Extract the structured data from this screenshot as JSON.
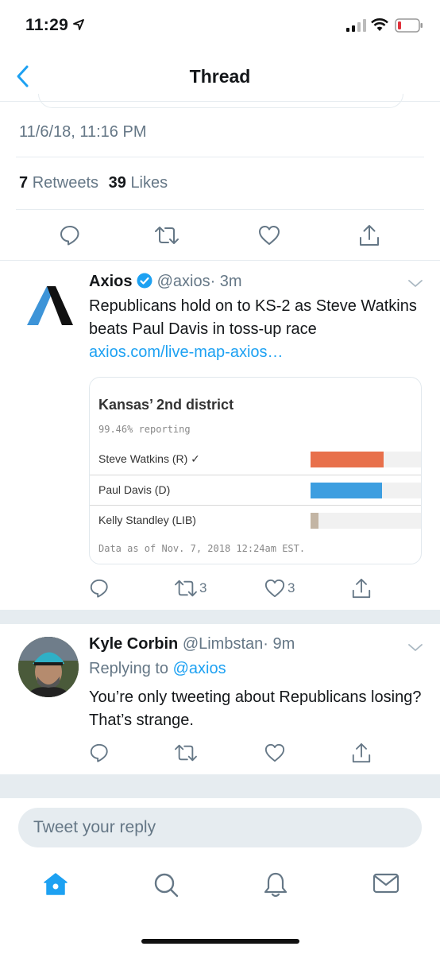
{
  "status_bar": {
    "time": "11:29"
  },
  "nav": {
    "title": "Thread"
  },
  "focused_tweet": {
    "timestamp": "11/6/18, 11:16 PM",
    "retweet_count": "7",
    "retweet_label": "Retweets",
    "like_count": "39",
    "like_label": "Likes"
  },
  "tweets": [
    {
      "name": "Axios",
      "handle": "@axios",
      "time": "· 3m",
      "verified": true,
      "text": "Republicans hold on to KS-2 as Steve Watkins beats Paul Davis in toss-up race",
      "link": "axios.com/live-map-axios…",
      "retweets": "3",
      "likes": "3",
      "card": {
        "title": "Kansas’ 2nd district",
        "reporting": "99.46% reporting",
        "candidates": [
          {
            "name": "Steve Watkins (R)",
            "winner": true,
            "share": 0.65,
            "color": "#e8704b"
          },
          {
            "name": "Paul Davis (D)",
            "winner": false,
            "share": 0.64,
            "color": "#3d9ee0"
          },
          {
            "name": "Kelly Standley (LIB)",
            "winner": false,
            "share": 0.07,
            "color": "#c3b5a4"
          }
        ],
        "footer": "Data as of Nov. 7, 2018 12:24am EST."
      }
    },
    {
      "name": "Kyle Corbin",
      "handle": "@Limbstan",
      "time": "· 9m",
      "replying_prefix": "Replying to",
      "replying_to": "@axios",
      "text": "You’re only tweeting about Republicans losing?  That’s strange."
    }
  ],
  "reply": {
    "placeholder": "Tweet your reply"
  },
  "colors": {
    "accent": "#1da1f2",
    "muted": "#657786",
    "border": "#e6ecf0"
  }
}
